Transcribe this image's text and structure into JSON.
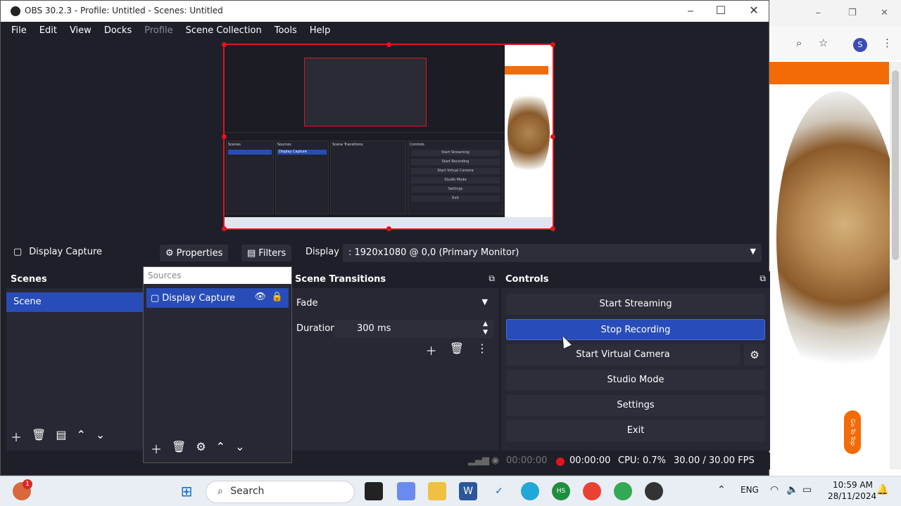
{
  "window": {
    "title": "OBS 30.2.3 - Profile: Untitled - Scenes: Untitled",
    "minimize": "⎯",
    "maximize": "☐",
    "close": "✕"
  },
  "menu": [
    "File",
    "Edit",
    "View",
    "Docks",
    "Profile",
    "Scene Collection",
    "Tools",
    "Help"
  ],
  "source_bar": {
    "source_name": "Display Capture",
    "properties_label": "Properties",
    "filters_label": "Filters",
    "display_label": "Display",
    "display_value": ": 1920x1080 @ 0,0 (Primary Monitor)"
  },
  "scenes": {
    "title": "Scenes",
    "items": [
      "Scene"
    ]
  },
  "sources": {
    "title": "Sources",
    "items": [
      "Display Capture"
    ]
  },
  "transitions": {
    "title": "Scene Transitions",
    "type": "Fade",
    "duration_label": "Duration",
    "duration_value": "300 ms"
  },
  "controls": {
    "title": "Controls",
    "start_streaming": "Start Streaming",
    "stop_recording": "Stop Recording",
    "start_virtual_camera": "Start Virtual Camera",
    "studio_mode": "Studio Mode",
    "settings": "Settings",
    "exit": "Exit"
  },
  "status": {
    "stream_time": "00:00:00",
    "record_time": "00:00:00",
    "cpu": "CPU: 0.7%",
    "fps": "30.00 / 30.00 FPS"
  },
  "preview_mini": {
    "scenes": "Scenes",
    "sources": "Sources",
    "transitions": "Scene Transitions",
    "controls": "Controls",
    "display_capture": "Display Capture",
    "start_streaming": "Start Streaming",
    "start_recording": "Start Recording",
    "virtual_camera": "Start Virtual Camera",
    "studio_mode": "Studio Mode",
    "settings": "Settings",
    "exit": "Exit"
  },
  "browser": {
    "go_to_top": "Go To Top",
    "avatar_letter": "S"
  },
  "taskbar": {
    "search_placeholder": "Search",
    "notification_count": "1",
    "language": "ENG",
    "time": "10:59 AM",
    "date": "28/11/2024"
  },
  "colors": {
    "accent": "#284cb8",
    "panel": "#272834",
    "bg": "#1e1f29",
    "record_red": "#e0141e",
    "brand_orange": "#f26b07"
  }
}
